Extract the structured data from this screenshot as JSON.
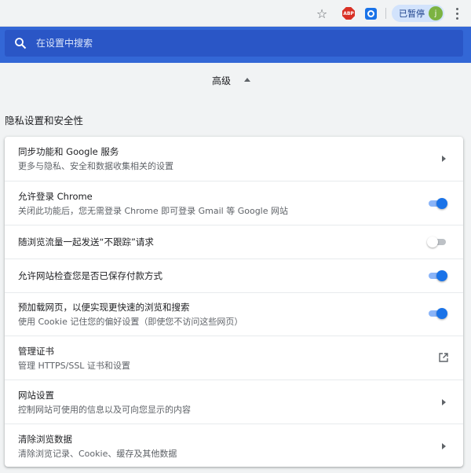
{
  "toolbar": {
    "abp_badge": "ABP",
    "profile_label": "已暂停",
    "avatar_initial": "j",
    "colors": {
      "avatar": "#7cb342",
      "chip": "#d2e3fc",
      "abp": "#d93025"
    }
  },
  "search": {
    "placeholder": "在设置中搜索"
  },
  "advanced": {
    "label": "高级"
  },
  "section": {
    "title": "隐私设置和安全性"
  },
  "rows": [
    {
      "title": "同步功能和 Google 服务",
      "subtitle": "更多与隐私、安全和数据收集相关的设置",
      "control": "chevron-right-icon"
    },
    {
      "title": "允许登录 Chrome",
      "subtitle": "关闭此功能后，您无需登录 Chrome 即可登录 Gmail 等 Google 网站",
      "control": "toggle",
      "checked": true
    },
    {
      "title": "随浏览流量一起发送“不跟踪”请求",
      "control": "toggle",
      "checked": false
    },
    {
      "title": "允许网站检查您是否已保存付款方式",
      "control": "toggle",
      "checked": true
    },
    {
      "title": "预加载网页，以便实现更快速的浏览和搜索",
      "subtitle": "使用 Cookie 记住您的偏好设置（即使您不访问这些网页）",
      "control": "toggle",
      "checked": true
    },
    {
      "title": "管理证书",
      "subtitle": "管理 HTTPS/SSL 证书和设置",
      "control": "open-in-new-icon"
    },
    {
      "title": "网站设置",
      "subtitle": "控制网站可使用的信息以及可向您显示的内容",
      "control": "chevron-right-icon"
    },
    {
      "title": "清除浏览数据",
      "subtitle": "清除浏览记录、Cookie、缓存及其他数据",
      "control": "chevron-right-icon"
    }
  ],
  "colors": {
    "header_blue": "#3367d6",
    "toggle_on": "#1a73e8"
  }
}
